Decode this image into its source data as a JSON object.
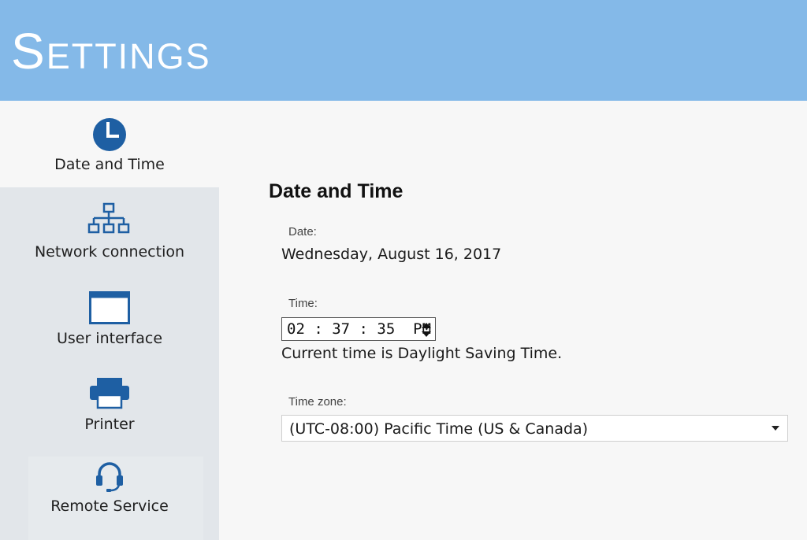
{
  "header": {
    "title": "Settings"
  },
  "sidebar": {
    "items": [
      {
        "label": "Date and Time",
        "icon": "clock-icon",
        "active": true
      },
      {
        "label": "Network connection",
        "icon": "network-icon",
        "active": false
      },
      {
        "label": "User interface",
        "icon": "window-icon",
        "active": false
      },
      {
        "label": "Printer",
        "icon": "printer-icon",
        "active": false
      },
      {
        "label": "Remote Service",
        "icon": "headset-icon",
        "active": false
      }
    ]
  },
  "main": {
    "title": "Date and Time",
    "date": {
      "label": "Date:",
      "value": "Wednesday, August 16, 2017"
    },
    "time": {
      "label": "Time:",
      "value": "02 : 37 : 35  PM",
      "note": "Current time is Daylight Saving Time."
    },
    "timezone": {
      "label": "Time zone:",
      "value": "(UTC-08:00) Pacific Time (US & Canada)"
    }
  },
  "colors": {
    "header_bg": "#84b9e8",
    "sidebar_bg": "#e2e6ea",
    "icon_blue": "#1e5fa3"
  }
}
